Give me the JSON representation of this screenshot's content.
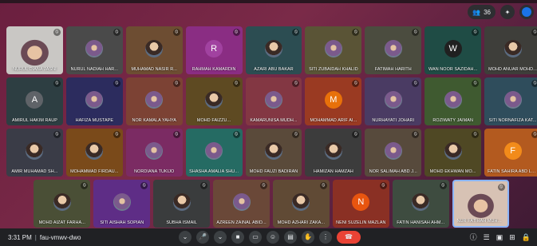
{
  "meeting": {
    "time": "3:31 PM",
    "code": "fau-vmwv-dwo"
  },
  "top": {
    "participants_count": "36"
  },
  "rows": [
    [
      {
        "name": "NURUL DIANA JASNI",
        "bg": "#c9c7c4",
        "type": "photo-large"
      },
      {
        "name": "NURUL NADIAH HAR...",
        "bg": "#4a4a4a",
        "type": "hijab"
      },
      {
        "name": "MUHAMAD NASIR R...",
        "bg": "#6d4d32",
        "type": "photo"
      },
      {
        "name": "RAHMAH KAMARDIN",
        "bg": "#8a2d83",
        "type": "letter",
        "letter": "R",
        "color": "#a142a0"
      },
      {
        "name": "AZARI ABU BAKAR",
        "bg": "#2c4d52",
        "type": "photo"
      },
      {
        "name": "SITI ZUBAIDAH KHALID",
        "bg": "#5a5436",
        "type": "hijab"
      },
      {
        "name": "FATIMAH HARITH",
        "bg": "#4b4c3f",
        "type": "hijab"
      },
      {
        "name": "WAN NOOR SAZIDAH...",
        "bg": "#1f4c45",
        "type": "letter",
        "letter": "W",
        "color": "#202020"
      },
      {
        "name": "MOHD ANUAR MOHD...",
        "bg": "#3e3e3a",
        "type": "photo"
      }
    ],
    [
      {
        "name": "AMIRUL HAKIM RAUP",
        "bg": "#2d3e42",
        "type": "letter",
        "letter": "A",
        "color": "#5f6368"
      },
      {
        "name": "HAFIZA MUSTAPE",
        "bg": "#2c2c5e",
        "type": "hijab"
      },
      {
        "name": "NOR KAMALA YAHYA",
        "bg": "#7c4234",
        "type": "hijab"
      },
      {
        "name": "MOHD FAIZZU...",
        "bg": "#5e4a22",
        "type": "photo"
      },
      {
        "name": "KAMARUNISA MUDH...",
        "bg": "#833743",
        "type": "hijab"
      },
      {
        "name": "MOHAMMAD ARIF AI...",
        "bg": "#9a3a22",
        "type": "letter",
        "letter": "M",
        "color": "#e8710a"
      },
      {
        "name": "NURHAYATI JOHARI",
        "bg": "#4a3b63",
        "type": "hijab"
      },
      {
        "name": "ROZIWATY JAIMAN",
        "bg": "#3f5a30",
        "type": "hijab"
      },
      {
        "name": "SITI NORNAFIZA KAT...",
        "bg": "#2f4d5c",
        "type": "hijab"
      }
    ],
    [
      {
        "name": "AMIR MUHAMAD SH...",
        "bg": "#3a3c47",
        "type": "photo"
      },
      {
        "name": "MOHAMMAD FIRDAU...",
        "bg": "#7a4a1a",
        "type": "photo"
      },
      {
        "name": "NORDIANA TUKIJO",
        "bg": "#7b2b63",
        "type": "hijab"
      },
      {
        "name": "SHASHA AMALIA SHU...",
        "bg": "#256b63",
        "type": "hijab"
      },
      {
        "name": "MOHD FAUZI BADIRAN",
        "bg": "#5a4a3a",
        "type": "photo"
      },
      {
        "name": "HAMIZAN HAMZAH",
        "bg": "#3c3c3c",
        "type": "photo"
      },
      {
        "name": "NOR SALIMAH ABD J...",
        "bg": "#574a3c",
        "type": "hijab"
      },
      {
        "name": "MOHD EKHWAN MO...",
        "bg": "#4f4824",
        "type": "photo"
      },
      {
        "name": "FATIN SAHIRA ABD LA...",
        "bg": "#b35a1f",
        "type": "letter",
        "letter": "F",
        "color": "#f28b1a"
      }
    ],
    [
      {
        "name": "MOHD AIZAT FARHA...",
        "bg": "#4a4f36",
        "type": "photo"
      },
      {
        "name": "SITI AISHAH SOPIAN",
        "bg": "#5e2d86",
        "type": "hijab"
      },
      {
        "name": "SUBHA ISMAIL",
        "bg": "#3a3c3d",
        "type": "photo"
      },
      {
        "name": "AZREEN ZAINAL ABID...",
        "bg": "#6a4838",
        "type": "hijab"
      },
      {
        "name": "MOHD AZHARI ZAKA...",
        "bg": "#604a35",
        "type": "photo"
      },
      {
        "name": "NENI SUZELIN MAZLAN",
        "bg": "#8a3024",
        "type": "letter",
        "letter": "N",
        "color": "#e8550f"
      },
      {
        "name": "FATIN HANISAH AHM...",
        "bg": "#3e4c40",
        "type": "photo"
      },
      {
        "name": "NUR FATIHAH MUHA...",
        "bg": "#d7c2b4",
        "type": "photo-large",
        "self": true
      }
    ]
  ],
  "controls": {
    "mic": "🎤",
    "mic_more": "⌄",
    "cam": "■",
    "cam_more": "⌄",
    "cc": "▭",
    "emoji": "☺",
    "present": "▤",
    "hand": "✋",
    "more": "⋮",
    "end": "☎"
  },
  "right_controls": {
    "info": "ⓘ",
    "people": "☰",
    "chat": "▣",
    "activities": "⊞",
    "lock": "🔒"
  }
}
